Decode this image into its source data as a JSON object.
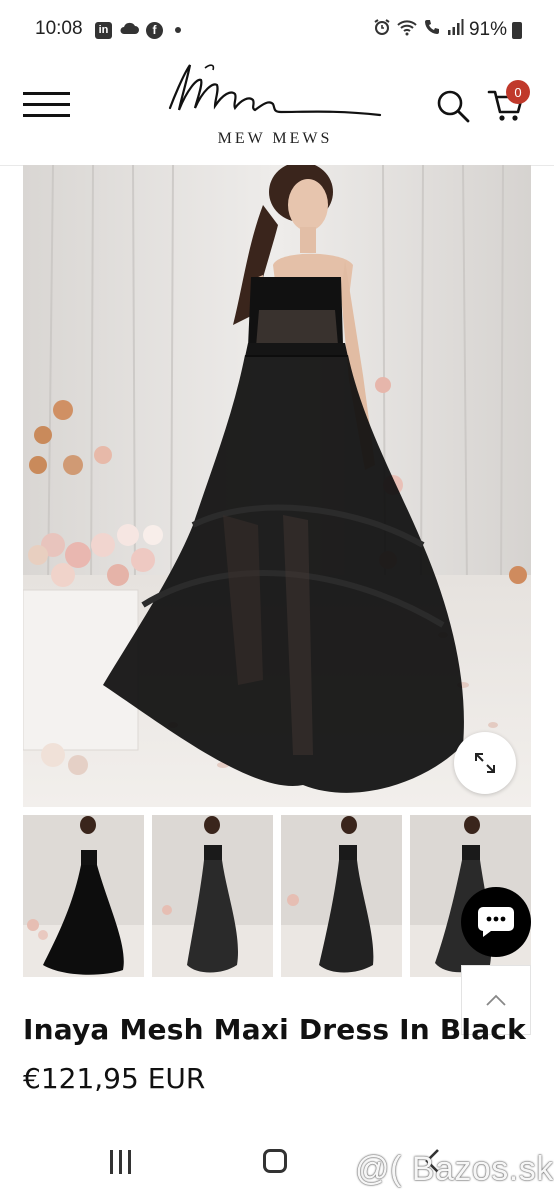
{
  "status_bar": {
    "time": "10:08",
    "linkedin_glyph": "in",
    "facebook_glyph": "f",
    "battery": "91%",
    "icons_left": [
      "linkedin-icon",
      "cloud-icon",
      "facebook-icon",
      "dot-icon"
    ],
    "icons_right": [
      "alarm-icon",
      "wifi-icon",
      "wifi-calling-icon",
      "signal-icon",
      "battery-icon"
    ]
  },
  "header": {
    "brand_name": "MEW MEWS",
    "cart_count": "0",
    "colors": {
      "badge": "#c0392b"
    }
  },
  "gallery": {
    "main_image": "product-photo-black-tulle-maxi-dress",
    "thumbnails": [
      "thumb-1",
      "thumb-2",
      "thumb-3",
      "thumb-4"
    ],
    "active_index": 0
  },
  "product": {
    "title": "Inaya Mesh Maxi Dress In Black",
    "price": "€121,95 EUR"
  },
  "watermark": "@( Bazos.sk",
  "nav": {
    "buttons": [
      "recents-button",
      "home-button",
      "back-button"
    ]
  }
}
